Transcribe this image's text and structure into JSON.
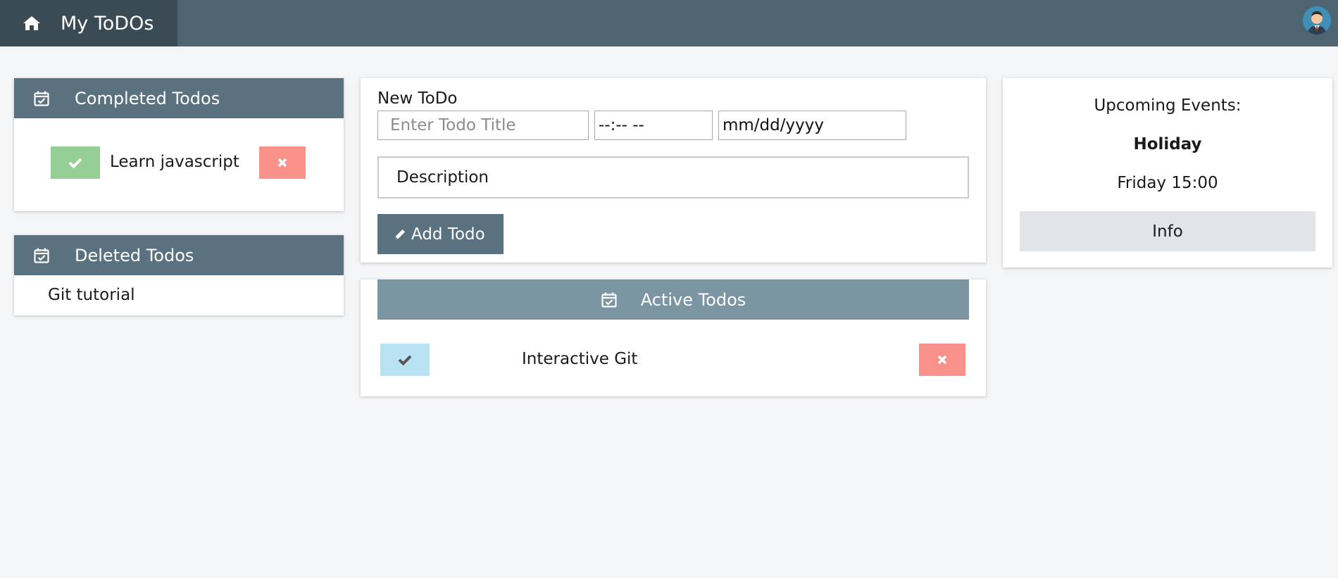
{
  "app": {
    "title": "My ToDOs",
    "home_icon": "home-icon",
    "avatar_icon": "user-avatar"
  },
  "completed": {
    "header": "Completed Todos",
    "items": [
      {
        "title": "Learn javascript"
      }
    ]
  },
  "deleted": {
    "header": "Deleted Todos",
    "items": [
      {
        "title": "Git tutorial"
      }
    ]
  },
  "new_todo": {
    "heading": "New ToDo",
    "title_placeholder": "Enter Todo Title",
    "time_value": "--:-- --",
    "date_value": "mm/dd/yyyy",
    "description_placeholder": "Description",
    "add_label": "Add Todo"
  },
  "active": {
    "header": "Active Todos",
    "items": [
      {
        "title": "Interactive Git"
      }
    ]
  },
  "events": {
    "heading": "Upcoming Events:",
    "event_name": "Holiday",
    "event_time": "Friday 15:00",
    "info_label": "Info"
  },
  "colors": {
    "topbar": "#4e6471",
    "home": "#3a4b55",
    "card_header": "#5a7280",
    "active_header": "#7b95a2",
    "check_green": "#96cf96",
    "check_blue": "#b9e2f3",
    "delete_red": "#f7918a"
  }
}
